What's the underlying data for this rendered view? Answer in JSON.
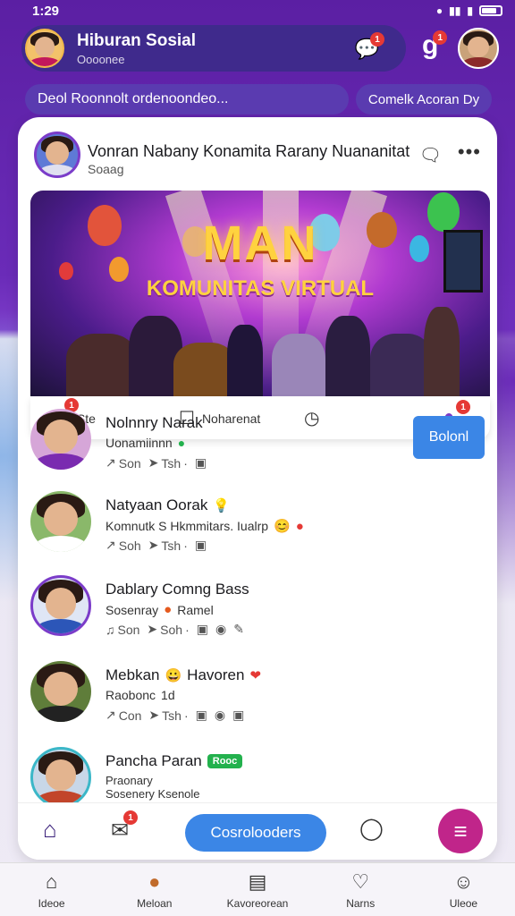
{
  "status": {
    "time": "1:29"
  },
  "header": {
    "title": "Hiburan Sosial",
    "subtitle": "Oooonee",
    "notif_badge": "1",
    "g_badge": "1"
  },
  "search": {
    "placeholder": "Deol Roonnolt ordenoondeo...",
    "filter_label": "Comelk Acoran Dy"
  },
  "post": {
    "author": "Vonran Nabany",
    "author_extra": "Konamita Rarany Nuananitat",
    "sub": "Soaag",
    "media_title": "MAN",
    "media_subtitle": "KOMUNITAS VIRTUAL",
    "actions": [
      {
        "label": "Ste",
        "badge": "1"
      },
      {
        "label": "Noharenat"
      },
      {
        "label": ""
      },
      {
        "label": "",
        "badge": "1"
      }
    ]
  },
  "list": [
    {
      "name": "Nolnnry Narak",
      "sub": "Uonamiinnn",
      "meta1": "Son",
      "meta2": "Tsh",
      "button": "Bolonl"
    },
    {
      "name": "Natyaan Oorak",
      "sub": "Komnutk S Hkmmitars. Iualrp",
      "meta1": "Soh",
      "meta2": "Tsh"
    },
    {
      "name": "Dablary Comng Bass",
      "sub": "Sosenray",
      "sub2": "Ramel",
      "meta1": "Son",
      "meta2": "Soh"
    },
    {
      "name": "Mebkan",
      "name2": "Havoren",
      "sub": "Raobonc",
      "sub2": "1d",
      "meta1": "Con",
      "meta2": "Tsh"
    },
    {
      "name": "Pancha Paran",
      "tag": "Rooc",
      "sub": "Praonary",
      "sub2": "Sosenery",
      "sub3": "Ksenole"
    }
  ],
  "card_bottom": {
    "main_button": "Cosrolooders",
    "chat_badge": "1"
  },
  "nav": [
    {
      "label": "Ideoe"
    },
    {
      "label": "Meloan"
    },
    {
      "label": "Kavoreorean"
    },
    {
      "label": "Narns"
    },
    {
      "label": "Uleoe"
    }
  ]
}
